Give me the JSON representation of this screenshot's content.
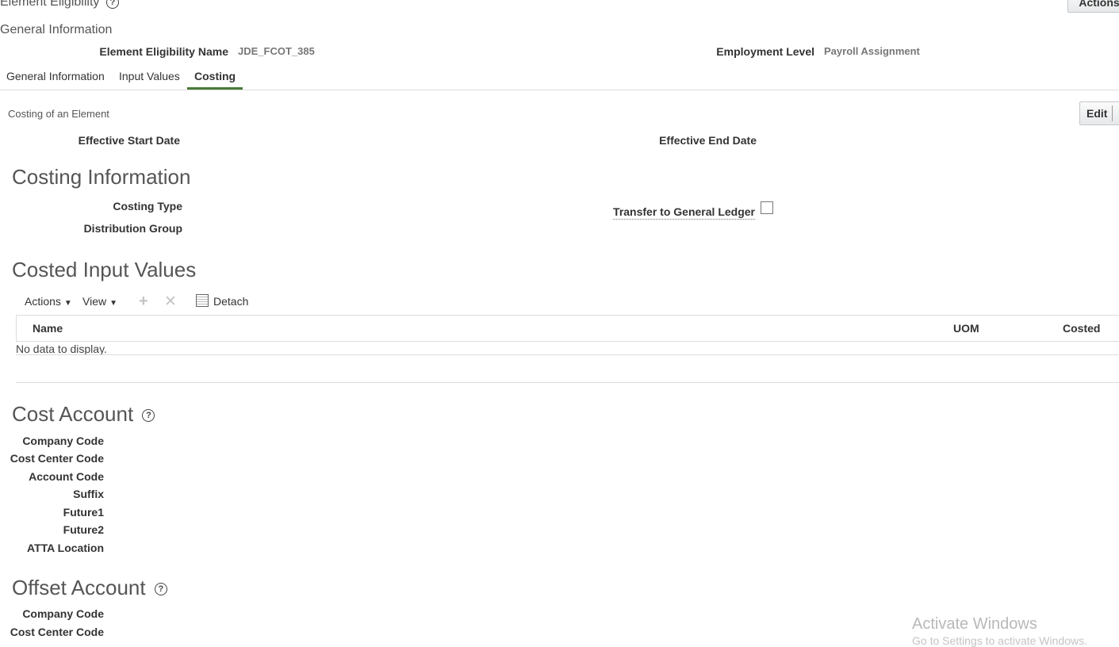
{
  "page": {
    "title": "Element Eligibility",
    "actions_label": "Actions",
    "subtitle": "General Information"
  },
  "summary": {
    "eligibility_name_label": "Element Eligibility Name",
    "eligibility_name_value": "JDE_FCOT_385",
    "employment_level_label": "Employment Level",
    "employment_level_value": "Payroll Assignment"
  },
  "tabs": [
    {
      "label": "General Information",
      "active": false
    },
    {
      "label": "Input Values",
      "active": false
    },
    {
      "label": "Costing",
      "active": true
    }
  ],
  "costing": {
    "caption": "Costing of an Element",
    "edit_label": "Edit",
    "effective_start_label": "Effective Start Date",
    "effective_end_label": "Effective End Date"
  },
  "costing_information": {
    "heading": "Costing Information",
    "costing_type_label": "Costing Type",
    "distribution_group_label": "Distribution Group",
    "transfer_gl_label": "Transfer to General Ledger",
    "transfer_gl_checked": false
  },
  "costed_input_values": {
    "heading": "Costed Input Values",
    "toolbar": {
      "actions_label": "Actions",
      "view_label": "View",
      "detach_label": "Detach"
    },
    "columns": [
      "Name",
      "UOM",
      "Costed"
    ],
    "empty_text": "No data to display."
  },
  "cost_account": {
    "heading": "Cost Account",
    "fields": [
      "Company Code",
      "Cost Center Code",
      "Account Code",
      "Suffix",
      "Future1",
      "Future2",
      "ATTA Location"
    ]
  },
  "offset_account": {
    "heading": "Offset Account",
    "fields": [
      "Company Code",
      "Cost Center Code"
    ]
  },
  "watermark": {
    "line1": "Activate Windows",
    "line2": "Go to Settings to activate Windows."
  },
  "colors": {
    "tab_underline": "#4a7a35",
    "label_text": "#333333",
    "value_text": "#777777"
  }
}
